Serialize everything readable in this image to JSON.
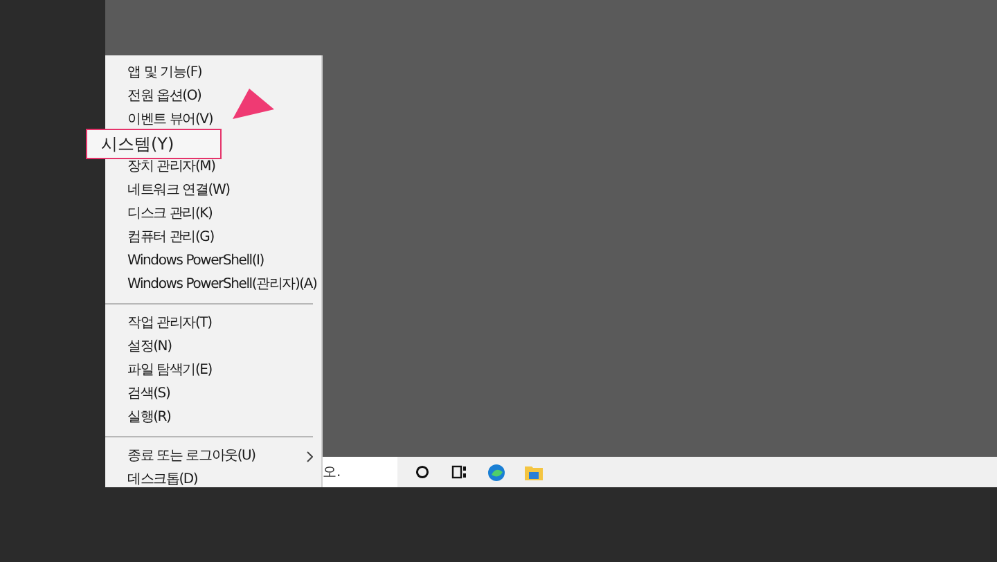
{
  "menu": {
    "groups": [
      [
        {
          "label": "앱 및 기능(F)",
          "has_submenu": false,
          "highlighted": false
        },
        {
          "label": "전원 옵션(O)",
          "has_submenu": false,
          "highlighted": false
        },
        {
          "label": "이벤트 뷰어(V)",
          "has_submenu": false,
          "highlighted": false
        },
        {
          "label": "시스템(Y)",
          "has_submenu": false,
          "highlighted": true
        },
        {
          "label": "장치 관리자(M)",
          "has_submenu": false,
          "highlighted": false
        },
        {
          "label": "네트워크 연결(W)",
          "has_submenu": false,
          "highlighted": false
        },
        {
          "label": "디스크 관리(K)",
          "has_submenu": false,
          "highlighted": false
        },
        {
          "label": "컴퓨터 관리(G)",
          "has_submenu": false,
          "highlighted": false
        },
        {
          "label": "Windows PowerShell(I)",
          "has_submenu": false,
          "highlighted": false
        },
        {
          "label": "Windows PowerShell(관리자)(A)",
          "has_submenu": false,
          "highlighted": false
        }
      ],
      [
        {
          "label": "작업 관리자(T)",
          "has_submenu": false,
          "highlighted": false
        },
        {
          "label": "설정(N)",
          "has_submenu": false,
          "highlighted": false
        },
        {
          "label": "파일 탐색기(E)",
          "has_submenu": false,
          "highlighted": false
        },
        {
          "label": "검색(S)",
          "has_submenu": false,
          "highlighted": false
        },
        {
          "label": "실행(R)",
          "has_submenu": false,
          "highlighted": false
        }
      ],
      [
        {
          "label": "종료 또는 로그아웃(U)",
          "has_submenu": true,
          "highlighted": false
        },
        {
          "label": "데스크톱(D)",
          "has_submenu": false,
          "highlighted": false
        }
      ]
    ]
  },
  "taskbar": {
    "search_text": "오."
  }
}
